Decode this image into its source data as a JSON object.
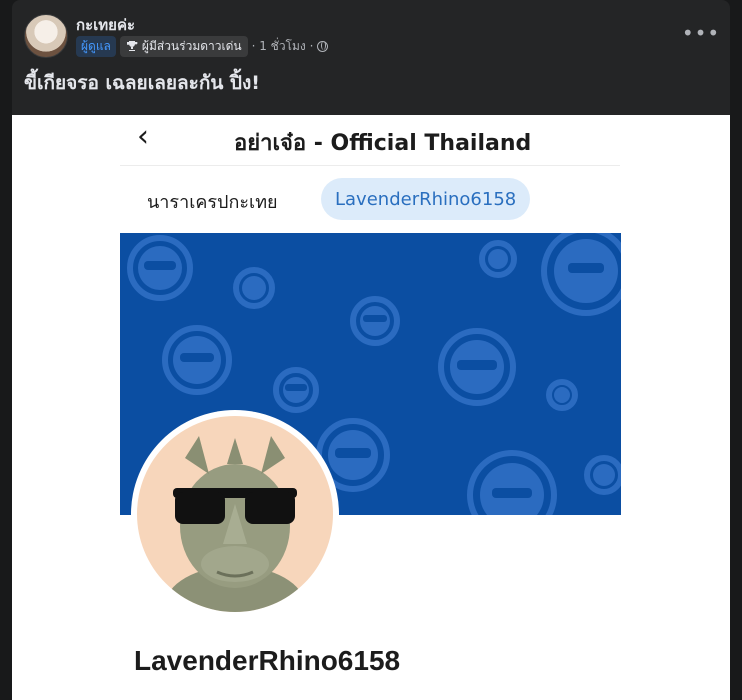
{
  "post": {
    "author": "กะเทยค่ะ",
    "badge_admin": "ผู้ดูแล",
    "badge_top_contributor": "ผู้มีส่วนร่วมดาวเด่น",
    "time": "· 1 ชั่วโมง ·",
    "more_label": "•••",
    "text": "ขี้เกียจรอ เฉลยเลยละกัน ปิ้ง!"
  },
  "screenshot": {
    "back_label": "‹",
    "title": "อย่าเจ๋อ - Official Thailand",
    "tab_left": "นาราเครปกะเทย",
    "tab_right": "LavenderRhino6158",
    "username": "LavenderRhino6158",
    "cover_color": "#0b4ea2",
    "profile_bg": "#f7d6bb"
  },
  "icons": {
    "trophy": "trophy-icon",
    "globe": "globe-icon",
    "more": "more-icon",
    "back": "chevron-left-icon"
  }
}
